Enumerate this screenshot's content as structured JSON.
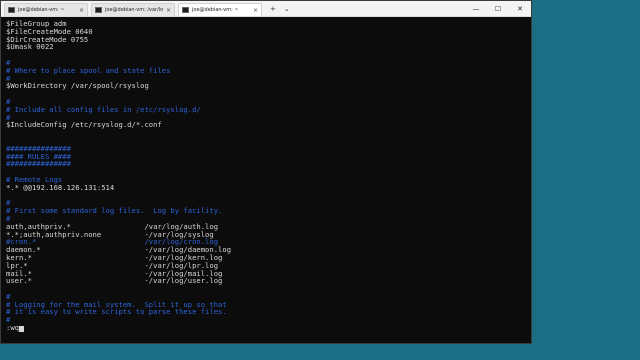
{
  "tabs": [
    {
      "label": "joe@debian-vm: ~",
      "active": false
    },
    {
      "label": "joe@debian-vm: /var/log",
      "active": false
    },
    {
      "label": "joe@debian-vm: ~",
      "active": true
    }
  ],
  "tab_actions": {
    "new_tab": "+",
    "dropdown": "⌄"
  },
  "window_controls": {
    "minimize": "—",
    "maximize": "☐",
    "close": "✕"
  },
  "terminal_lines": [
    {
      "text": "$FileGroup adm",
      "style": "normal"
    },
    {
      "text": "$FileCreateMode 0640",
      "style": "normal"
    },
    {
      "text": "$DirCreateMode 0755",
      "style": "normal"
    },
    {
      "text": "$Umask 0022",
      "style": "normal"
    },
    {
      "text": "",
      "style": "normal"
    },
    {
      "text": "#",
      "style": "comment"
    },
    {
      "text": "# Where to place spool and state files",
      "style": "comment"
    },
    {
      "text": "#",
      "style": "comment"
    },
    {
      "text": "$WorkDirectory /var/spool/rsyslog",
      "style": "normal"
    },
    {
      "text": "",
      "style": "normal"
    },
    {
      "text": "#",
      "style": "comment"
    },
    {
      "text": "# Include all config files in /etc/rsyslog.d/",
      "style": "comment"
    },
    {
      "text": "#",
      "style": "comment"
    },
    {
      "text": "$IncludeConfig /etc/rsyslog.d/*.conf",
      "style": "normal"
    },
    {
      "text": "",
      "style": "normal"
    },
    {
      "text": "",
      "style": "normal"
    },
    {
      "text": "###############",
      "style": "comment"
    },
    {
      "text": "#### RULES ####",
      "style": "comment"
    },
    {
      "text": "###############",
      "style": "comment"
    },
    {
      "text": "",
      "style": "normal"
    },
    {
      "text": "# Remote Logs",
      "style": "comment"
    },
    {
      "text": "*.* @@192.168.126.131:514",
      "style": "normal"
    },
    {
      "text": "",
      "style": "normal"
    },
    {
      "text": "#",
      "style": "comment"
    },
    {
      "text": "# First some standard log files.  Log by facility.",
      "style": "comment"
    },
    {
      "text": "#",
      "style": "comment"
    },
    {
      "text": "auth,authpriv.*                 /var/log/auth.log",
      "style": "normal"
    },
    {
      "text": "*.*;auth,authpriv.none          -/var/log/syslog",
      "style": "normal"
    },
    {
      "text": "#cron.*                         /var/log/cron.log",
      "style": "comment"
    },
    {
      "text": "daemon.*                        -/var/log/daemon.log",
      "style": "normal"
    },
    {
      "text": "kern.*                          -/var/log/kern.log",
      "style": "normal"
    },
    {
      "text": "lpr.*                           -/var/log/lpr.log",
      "style": "normal"
    },
    {
      "text": "mail.*                          -/var/log/mail.log",
      "style": "normal"
    },
    {
      "text": "user.*                          -/var/log/user.log",
      "style": "normal"
    },
    {
      "text": "",
      "style": "normal"
    },
    {
      "text": "#",
      "style": "comment"
    },
    {
      "text": "# Logging for the mail system.  Split it up so that",
      "style": "comment"
    },
    {
      "text": "# it is easy to write scripts to parse these files.",
      "style": "comment"
    },
    {
      "text": "#",
      "style": "comment"
    }
  ],
  "command_line": ":wq",
  "colors": {
    "desktop": "#1b6e84",
    "terminal_bg": "#0c0c0c",
    "text": "#d8d8d8",
    "comment": "#2d63d6"
  }
}
